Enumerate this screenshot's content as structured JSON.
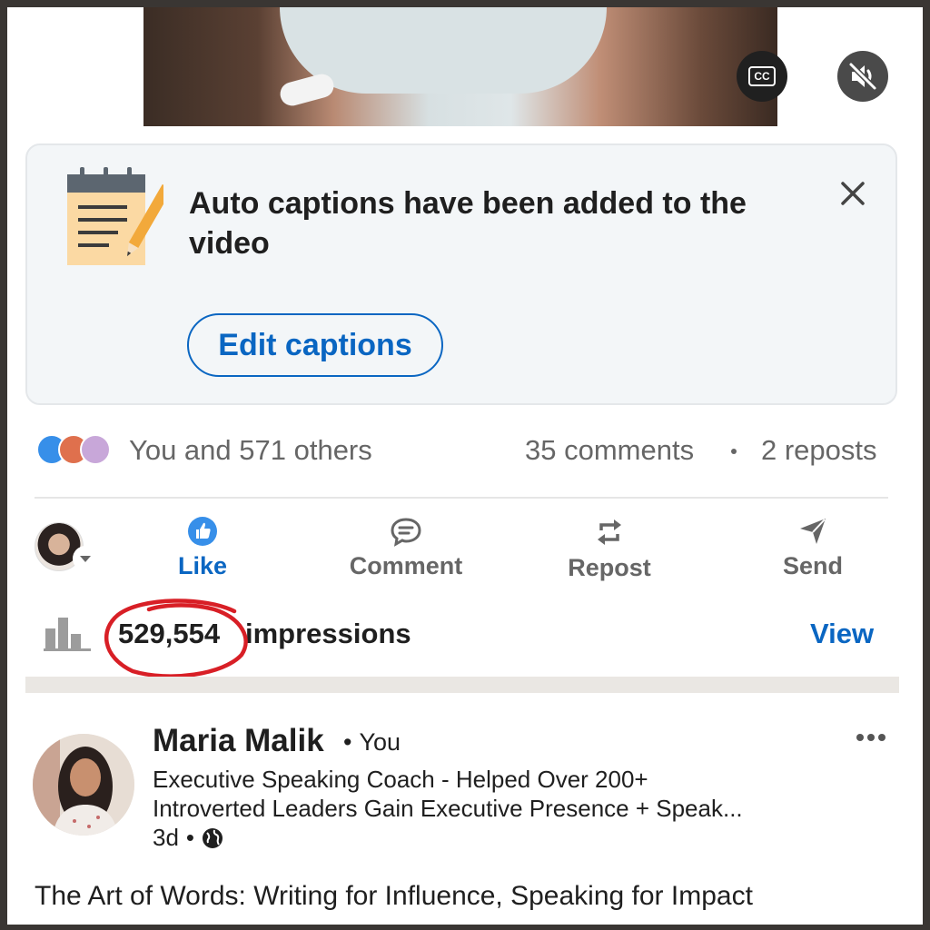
{
  "video": {
    "cc_label": "CC",
    "cc_icon": "closed-captions-icon",
    "mute_icon": "speaker-muted-icon"
  },
  "caption_card": {
    "icon": "notepad-pencil-icon",
    "title": "Auto captions have been added to the video",
    "close_icon": "close-icon",
    "edit_button": "Edit captions"
  },
  "social": {
    "reaction_icons": [
      "like-reaction-icon",
      "love-reaction-icon",
      "support-reaction-icon"
    ],
    "reactions_text": "You and 571 others",
    "comments_text": "35 comments",
    "reposts_text": "2 reposts"
  },
  "actions": {
    "like": "Like",
    "comment": "Comment",
    "repost": "Repost",
    "send": "Send"
  },
  "impressions": {
    "count": "529,554",
    "label": "impressions",
    "view_link": "View"
  },
  "next_post": {
    "author_name": "Maria Malik",
    "relation": "You",
    "headline_line1": "Executive Speaking Coach - Helped Over 200+",
    "headline_line2": "Introverted Leaders Gain Executive Presence + Speak...",
    "age": "3d",
    "visibility_icon": "globe-icon",
    "text": "The Art of Words: Writing for Influence, Speaking for Impact"
  },
  "colors": {
    "accent": "#0a66c2",
    "annotation_red": "#d81f26",
    "muted_text": "#666666",
    "card_bg": "#f3f6f8"
  }
}
